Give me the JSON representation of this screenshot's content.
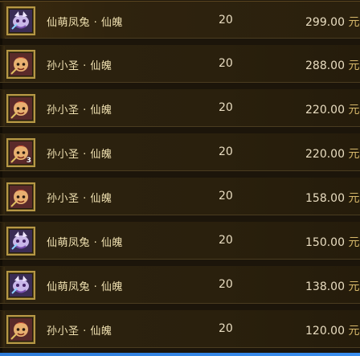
{
  "currency_symbol": "元",
  "rows": [
    {
      "name": "仙萌凤兔 · 仙魄",
      "qty": "20",
      "price": "299.00",
      "icon": "beast-icon-purple",
      "badge": ""
    },
    {
      "name": "孙小圣 · 仙魄",
      "qty": "20",
      "price": "288.00",
      "icon": "character-icon-red",
      "badge": ""
    },
    {
      "name": "孙小圣 · 仙魄",
      "qty": "20",
      "price": "220.00",
      "icon": "character-icon-red",
      "badge": ""
    },
    {
      "name": "孙小圣 · 仙魄",
      "qty": "20",
      "price": "220.00",
      "icon": "character-icon-red",
      "badge": "3"
    },
    {
      "name": "孙小圣 · 仙魄",
      "qty": "20",
      "price": "158.00",
      "icon": "character-icon-red",
      "badge": ""
    },
    {
      "name": "仙萌凤兔 · 仙魄",
      "qty": "20",
      "price": "150.00",
      "icon": "beast-icon-purple",
      "badge": ""
    },
    {
      "name": "仙萌凤兔 · 仙魄",
      "qty": "20",
      "price": "138.00",
      "icon": "beast-icon-purple",
      "badge": ""
    },
    {
      "name": "孙小圣 · 仙魄",
      "qty": "20",
      "price": "120.00",
      "icon": "character-icon-red",
      "badge": ""
    }
  ],
  "colors": {
    "accent_blue": "#2d7bd8",
    "gold_border": "#b69845",
    "text": "#e8dcc0"
  }
}
